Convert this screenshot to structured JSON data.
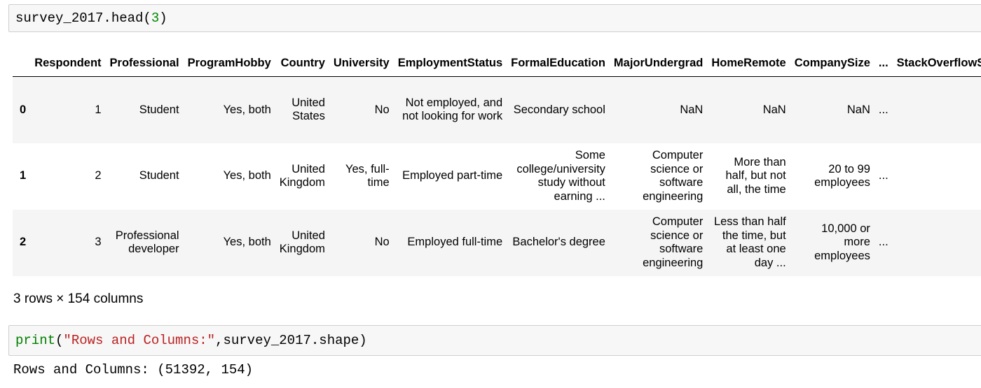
{
  "cell1": {
    "code_prefix": "survey_2017.head(",
    "code_arg": "3",
    "code_suffix": ")"
  },
  "table": {
    "columns": [
      "",
      "Respondent",
      "Professional",
      "ProgramHobby",
      "Country",
      "University",
      "EmploymentStatus",
      "FormalEducation",
      "MajorUndergrad",
      "HomeRemote",
      "CompanySize",
      "...",
      "StackOverflowSatisfaction"
    ],
    "rows": [
      [
        "0",
        "1",
        "Student",
        "Yes, both",
        "United States",
        "No",
        "Not employed, and not looking for work",
        "Secondary school",
        "NaN",
        "NaN",
        "NaN",
        "...",
        ""
      ],
      [
        "1",
        "2",
        "Student",
        "Yes, both",
        "United Kingdom",
        "Yes, full-time",
        "Employed part-time",
        "Some college/university study without earning ...",
        "Computer science or software engineering",
        "More than half, but not all, the time",
        "20 to 99 employees",
        "...",
        ""
      ],
      [
        "2",
        "3",
        "Professional developer",
        "Yes, both",
        "United Kingdom",
        "No",
        "Employed full-time",
        "Bachelor's degree",
        "Computer science or software engineering",
        "Less than half the time, but at least one day ...",
        "10,000 or more employees",
        "...",
        ""
      ]
    ]
  },
  "shape_text": "3 rows × 154 columns",
  "cell2": {
    "func": "print",
    "open": "(",
    "string": "\"Rows and Columns:\"",
    "rest": ",survey_2017.shape)"
  },
  "output": "Rows and Columns: (51392, 154)"
}
